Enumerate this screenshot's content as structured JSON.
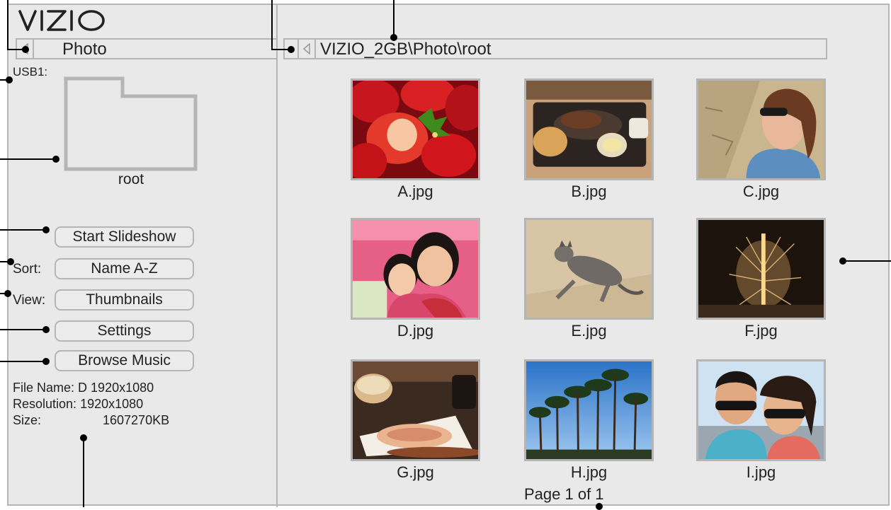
{
  "brand": {
    "logo": "VIZIO"
  },
  "left_panel": {
    "path_label": "Photo",
    "device_label": "USB1:",
    "folder_name": "root",
    "buttons": {
      "slideshow": "Start Slideshow",
      "settings": "Settings",
      "browse_music": "Browse Music"
    },
    "sort": {
      "label": "Sort:",
      "value": "Name A-Z"
    },
    "view": {
      "label": "View:",
      "value": "Thumbnails"
    },
    "file_info": {
      "name_label": "File Name:",
      "name_value": "D 1920x1080",
      "resolution_label": "Resolution:",
      "resolution_value": "1920x1080",
      "size_label": "Size:",
      "size_value": "1607270KB"
    }
  },
  "main": {
    "path": "VIZIO_2GB\\Photo\\root",
    "thumbnails": [
      {
        "file": "A.jpg",
        "subject": "strawberries"
      },
      {
        "file": "B.jpg",
        "subject": "steak-plate"
      },
      {
        "file": "C.jpg",
        "subject": "woman-sunglasses"
      },
      {
        "file": "D.jpg",
        "subject": "two-girls"
      },
      {
        "file": "E.jpg",
        "subject": "cat-on-floor"
      },
      {
        "file": "F.jpg",
        "subject": "fireworks-tower"
      },
      {
        "file": "G.jpg",
        "subject": "gratin-dish"
      },
      {
        "file": "H.jpg",
        "subject": "palm-trees"
      },
      {
        "file": "I.jpg",
        "subject": "couple-selfie"
      }
    ],
    "page_label": "Page 1 of 1"
  },
  "colors": {
    "background": "#e9e9e9",
    "border": "#b5b5b5",
    "text": "#222222",
    "callout": "#000000"
  },
  "icons": {
    "back": "back-triangle-icon",
    "folder": "folder-icon"
  }
}
